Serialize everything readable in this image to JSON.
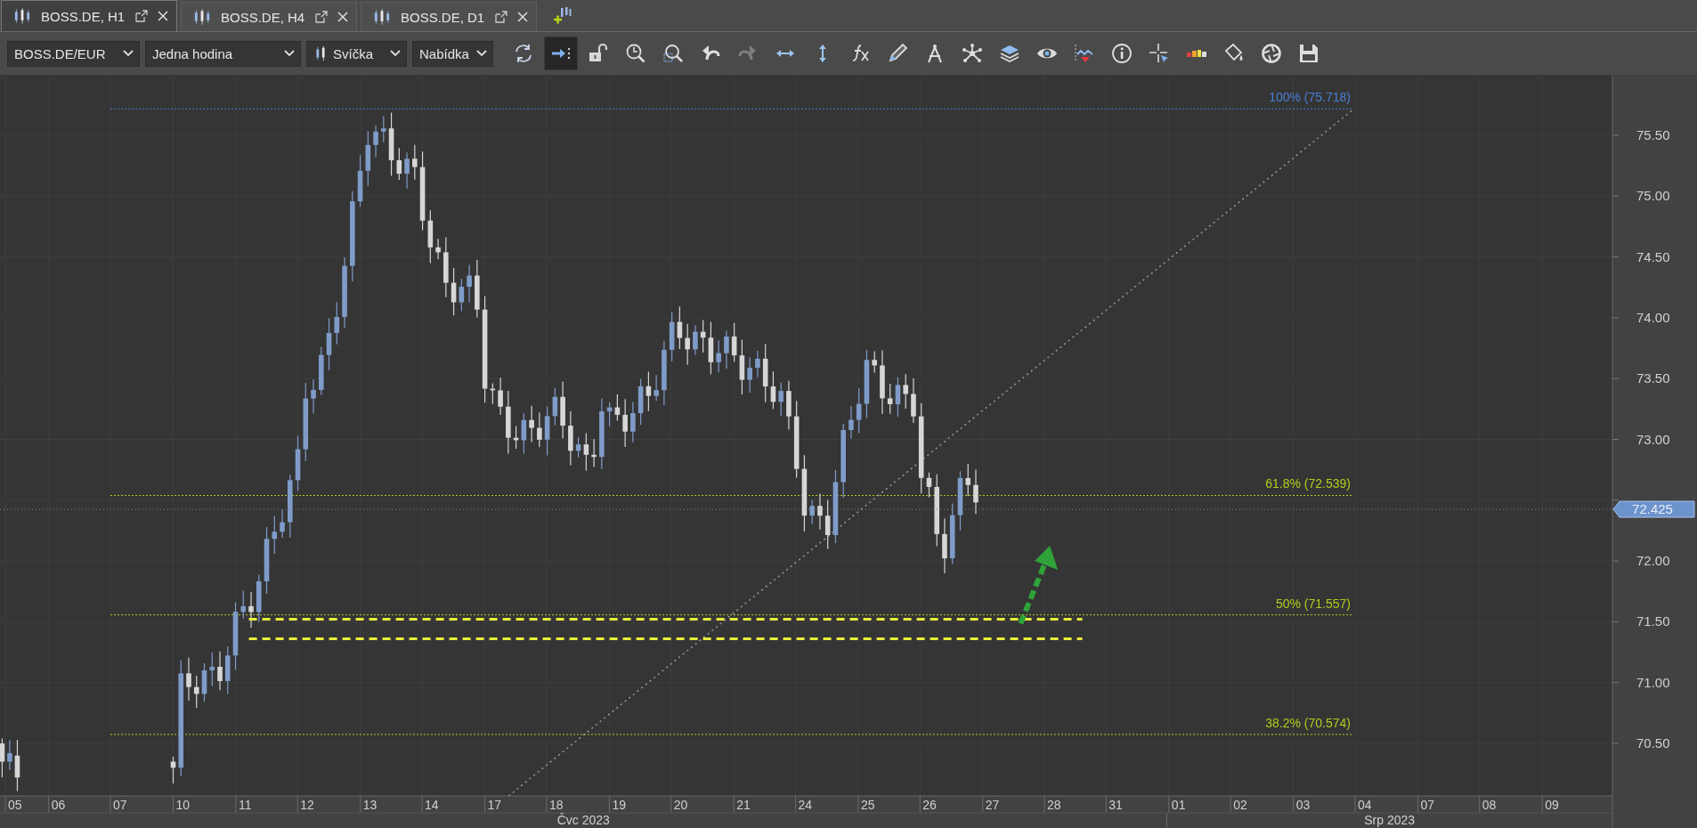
{
  "tabs": [
    {
      "label": "BOSS.DE, H1",
      "selected": true
    },
    {
      "label": "BOSS.DE, H4",
      "selected": false
    },
    {
      "label": "BOSS.DE, D1",
      "selected": false
    }
  ],
  "toolbar": {
    "symbol": "BOSS.DE/EUR",
    "timeframe": "Jedna hodina",
    "chart_type": "Svíčka",
    "price_type": "Nabídka",
    "tools": [
      {
        "kind": "refresh",
        "selected": false,
        "disabled": false
      },
      {
        "kind": "autoscroll",
        "selected": true,
        "disabled": false
      },
      {
        "kind": "lock",
        "selected": false,
        "disabled": false
      },
      {
        "kind": "clock-zoom",
        "selected": false,
        "disabled": false
      },
      {
        "kind": "area-zoom",
        "selected": false,
        "disabled": false
      },
      {
        "kind": "undo",
        "selected": false,
        "disabled": false
      },
      {
        "kind": "redo",
        "selected": false,
        "disabled": true
      },
      {
        "kind": "hscale",
        "selected": false,
        "disabled": false
      },
      {
        "kind": "vscale",
        "selected": false,
        "disabled": false
      },
      {
        "kind": "fx",
        "selected": false,
        "disabled": false
      },
      {
        "kind": "pencil",
        "selected": false,
        "disabled": false
      },
      {
        "kind": "compass",
        "selected": false,
        "disabled": false
      },
      {
        "kind": "network",
        "selected": false,
        "disabled": false
      },
      {
        "kind": "layers",
        "selected": false,
        "disabled": false
      },
      {
        "kind": "eye",
        "selected": false,
        "disabled": false
      },
      {
        "kind": "alert",
        "selected": false,
        "disabled": false
      },
      {
        "kind": "info",
        "selected": false,
        "disabled": false
      },
      {
        "kind": "crosshair",
        "selected": false,
        "disabled": false
      },
      {
        "kind": "bars",
        "selected": false,
        "disabled": false
      },
      {
        "kind": "bucket",
        "selected": false,
        "disabled": false
      },
      {
        "kind": "aperture",
        "selected": false,
        "disabled": false
      },
      {
        "kind": "save",
        "selected": false,
        "disabled": false
      }
    ]
  },
  "chart": {
    "price_labels": [
      "75.50",
      "75.00",
      "74.50",
      "74.00",
      "73.50",
      "73.00",
      "72.00",
      "71.50",
      "71.00",
      "70.50"
    ],
    "current_price": "72.425",
    "fib_levels": [
      {
        "label": "100% (75.718)",
        "color": "#4a7fd4"
      },
      {
        "label": "61.8% (72.539)",
        "color": "#b4cc1e"
      },
      {
        "label": "50% (71.557)",
        "color": "#b4cc1e"
      },
      {
        "label": "38.2% (70.574)",
        "color": "#b4cc1e"
      }
    ],
    "dates": [
      "05",
      "06",
      "07",
      "10",
      "11",
      "12",
      "13",
      "14",
      "17",
      "18",
      "19",
      "20",
      "21",
      "24",
      "25",
      "26",
      "27",
      "28",
      "31",
      "01",
      "02",
      "03",
      "04",
      "07",
      "08",
      "09"
    ],
    "months": [
      "Čvc 2023",
      "Srp 2023"
    ]
  }
}
